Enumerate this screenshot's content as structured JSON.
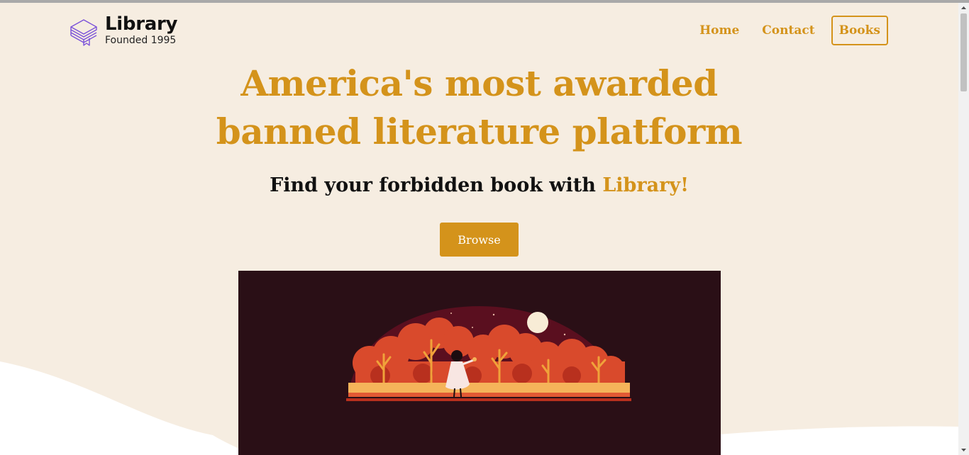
{
  "brand": {
    "name": "Library",
    "tagline": "Founded 1995",
    "icon": "stacked-books-icon",
    "icon_color": "#7b52d9"
  },
  "nav": {
    "home": "Home",
    "contact": "Contact",
    "books": "Books"
  },
  "hero": {
    "title_line1": "America's most awarded",
    "title_line2": "banned literature platform",
    "subtitle_prefix": "Find your forbidden book with ",
    "subtitle_accent": "Library!",
    "browse_label": "Browse"
  },
  "illustration": {
    "subject": "girl-in-autumn-forest-illustration"
  },
  "colors": {
    "accent": "#d4931b",
    "background": "#f6ede1",
    "illustration_bg": "#2a0f16"
  }
}
